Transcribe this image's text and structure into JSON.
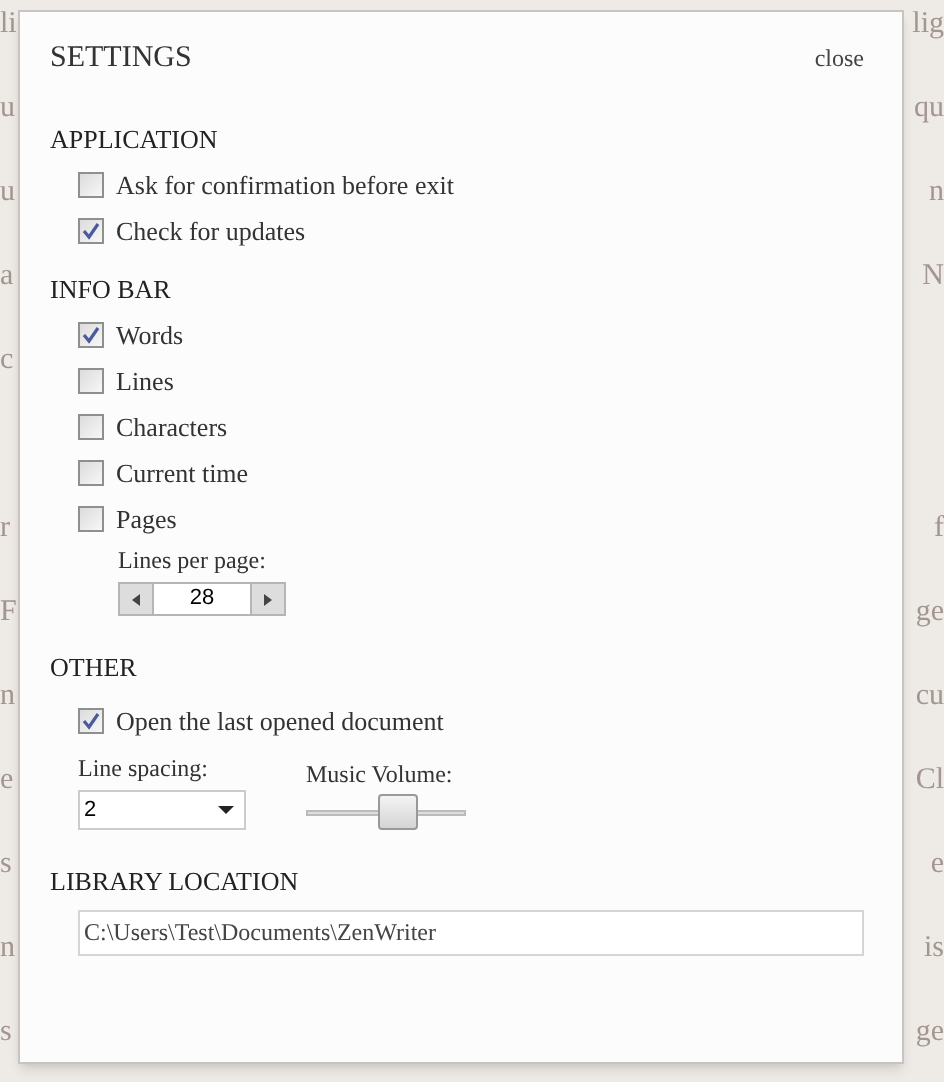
{
  "background_paragraphs": [
    [
      {
        "left": "li",
        "right": "lig"
      },
      {
        "left": "u",
        "right": "qu"
      },
      {
        "left": "u",
        "right": "n"
      },
      {
        "left": "a",
        "right": "N"
      },
      {
        "left": "c"
      }
    ],
    [
      {
        "left": "r",
        "right": "f"
      },
      {
        "left": "F",
        "right": "ge"
      },
      {
        "left": "n",
        "right": "cu"
      },
      {
        "left": "e",
        "right": "Cl"
      },
      {
        "left": "s",
        "right": "e"
      },
      {
        "left": "n",
        "right": "is"
      },
      {
        "left": "s",
        "right": "ge"
      }
    ]
  ],
  "settings": {
    "title": "SETTINGS",
    "close": "close",
    "application": {
      "heading": "APPLICATION",
      "options": [
        {
          "label": "Ask for confirmation before exit",
          "checked": false
        },
        {
          "label": "Check for updates",
          "checked": true
        }
      ]
    },
    "info_bar": {
      "heading": "INFO BAR",
      "options": [
        {
          "label": "Words",
          "checked": true
        },
        {
          "label": "Lines",
          "checked": false
        },
        {
          "label": "Characters",
          "checked": false
        },
        {
          "label": "Current time",
          "checked": false
        },
        {
          "label": "Pages",
          "checked": false
        }
      ],
      "lines_per_page": {
        "label": "Lines per page:",
        "value": "28"
      }
    },
    "other": {
      "heading": "OTHER",
      "options": [
        {
          "label": "Open the last opened document",
          "checked": true
        }
      ],
      "line_spacing": {
        "label": "Line spacing:",
        "value": "2"
      },
      "music_volume": {
        "label": "Music Volume:",
        "level": 0.6
      }
    },
    "library_location": {
      "heading": "LIBRARY LOCATION",
      "value": "C:\\Users\\Test\\Documents\\ZenWriter"
    }
  }
}
